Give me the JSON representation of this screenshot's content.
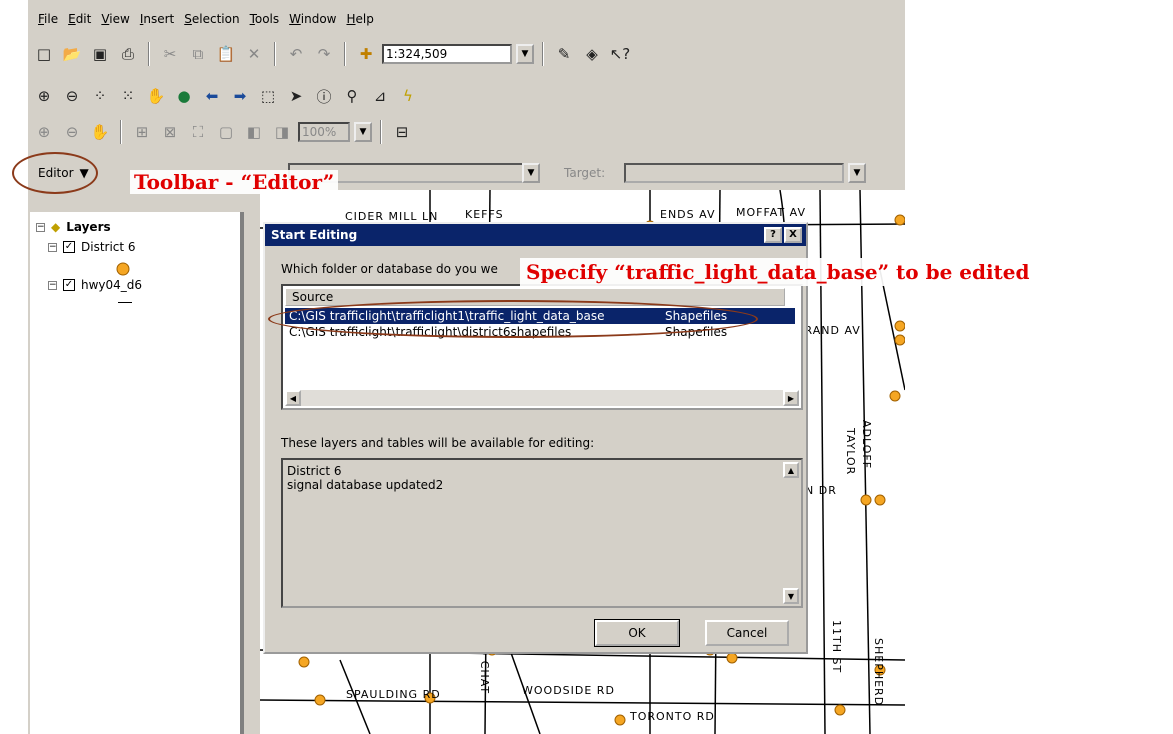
{
  "menu": [
    "File",
    "Edit",
    "View",
    "Insert",
    "Selection",
    "Tools",
    "Window",
    "Help"
  ],
  "toolbar": {
    "scale_value": "1:324,509",
    "zoom_value": "100%"
  },
  "editor_toolbar": {
    "editor_label": "Editor",
    "target_label": "Target:"
  },
  "toc": {
    "root": "Layers",
    "layer1": "District 6",
    "layer2": "hwy04_d6"
  },
  "dialog": {
    "title": "Start Editing",
    "help_btn": "?",
    "close_btn": "X",
    "prompt": "Which folder or database do you we",
    "column_header": "Source",
    "rows": [
      {
        "source": "C:\\GIS trafficlight\\trafficlight1\\traffic_light_data_base",
        "type": "Shapefiles"
      },
      {
        "source": "C:\\GIS trafficlight\\trafficlight\\district6shapefiles",
        "type": "Shapefiles"
      }
    ],
    "available_label": "These layers and tables will be available for editing:",
    "available_items": [
      "District 6",
      "signal database updated2"
    ],
    "ok": "OK",
    "cancel": "Cancel"
  },
  "annotations": {
    "toolbar_note": "Toolbar - “Editor”",
    "specify_note": "Specify “traffic_light_data_base” to be edited"
  },
  "map_labels": [
    "CIDER MILL LN",
    "KEFFS",
    "ENDS AV",
    "MOFFAT AV",
    "GRAND AV",
    "ADLOFF",
    "TAYLOR",
    "N DR",
    "11TH ST",
    "SHEPHERD",
    "SPAULDING RD",
    "WOODSIDE RD",
    "OLD CHAT",
    "TORONTO RD",
    "RD"
  ],
  "colors": {
    "accent": "#0a246a",
    "annotation": "#e00000",
    "circle": "#8b3a1a",
    "point": "#f5a623"
  }
}
